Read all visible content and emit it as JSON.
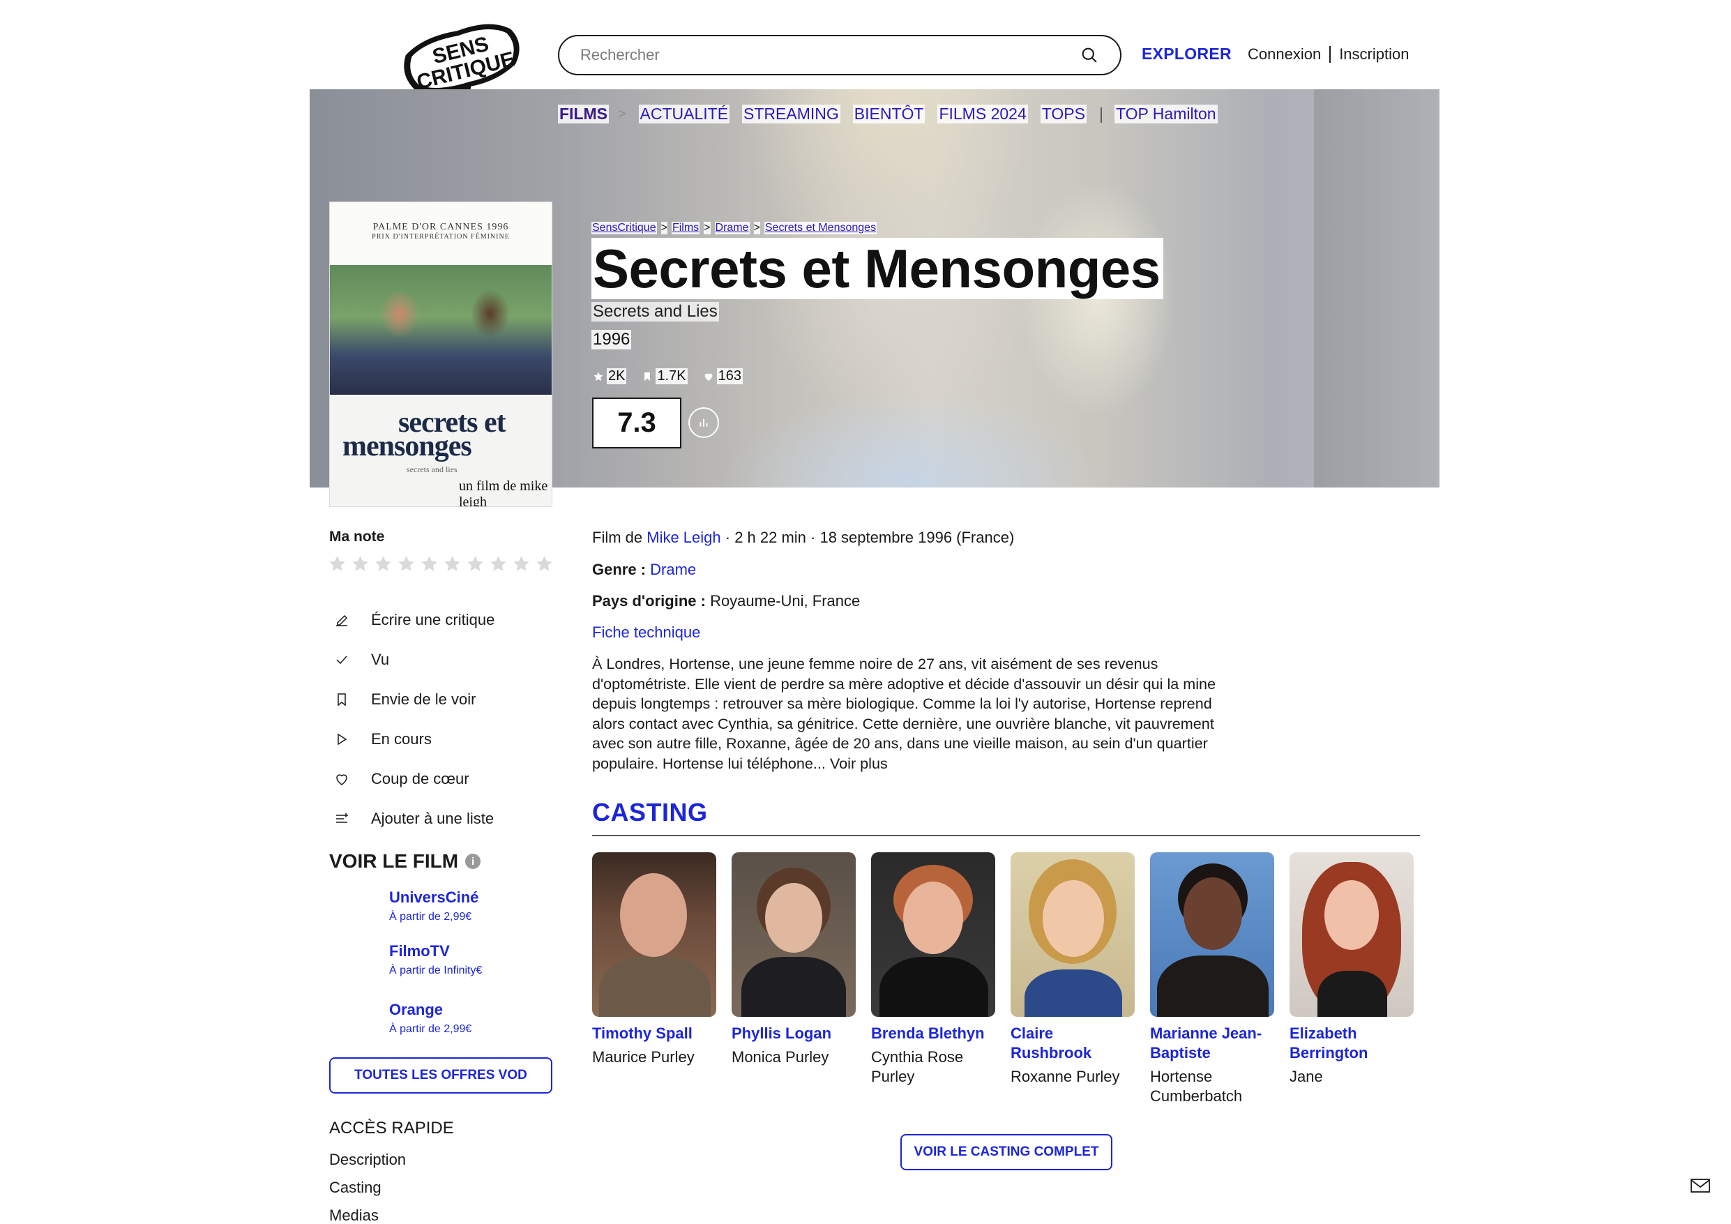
{
  "header": {
    "logo_text_1": "SENS",
    "logo_text_2": "CRITIQUE",
    "search_placeholder": "Rechercher",
    "explorer": "EXPLORER",
    "connexion": "Connexion",
    "inscription": "Inscription"
  },
  "subnav": {
    "films": "FILMS",
    "chevron": ">",
    "actualite": "ACTUALITÉ",
    "streaming": "STREAMING",
    "bientot": "BIENTÔT",
    "films2024": "FILMS 2024",
    "tops": "TOPS",
    "separator": "|",
    "top_hamilton": "TOP Hamilton"
  },
  "poster": {
    "award_1": "PALME D'OR CANNES 1996",
    "award_2": "PRIX D'INTERPRÉTATION FÉMININE",
    "title_1": "secrets et",
    "title_2": "mensonges",
    "subtitle": "secrets and lies",
    "director": "un film de mike leigh"
  },
  "breadcrumb": [
    "SensCritique",
    "Films",
    "Drame",
    "Secrets et Mensonges"
  ],
  "film": {
    "title": "Secrets et Mensonges",
    "original_title": "Secrets and Lies",
    "year": "1996",
    "ratings_count": "2K",
    "wishlist_count": "1.7K",
    "favorites_count": "163",
    "rating": "7.3",
    "meta_prefix": "Film de ",
    "director": "Mike Leigh",
    "meta_suffix": " · 2 h 22 min · 18 septembre 1996 (France)",
    "genre_label": "Genre : ",
    "genre": "Drame",
    "pays_label": "Pays d'origine : ",
    "pays": "Royaume-Uni, France",
    "fiche": "Fiche technique",
    "synopsis": "À Londres, Hortense, une jeune femme noire de 27 ans, vit aisément de ses revenus d'optométriste. Elle vient de perdre sa mère adoptive et décide d'assouvir un désir qui la mine depuis longtemps : retrouver sa mère biologique. Comme la loi l'y autorise, Hortense reprend alors contact avec Cynthia, sa génitrice. Cette dernière, une ouvrière blanche, vit pauvrement avec son autre fille, Roxanne, âgée de 20 ans, dans une vieille maison, au sein d'un quartier populaire. Hortense lui téléphone...",
    "voir_plus": "Voir plus"
  },
  "sidebar": {
    "ma_note": "Ma note",
    "stars_count": 10,
    "actions": [
      {
        "label": "Écrire une critique",
        "icon": "pencil-icon"
      },
      {
        "label": "Vu",
        "icon": "check-icon"
      },
      {
        "label": "Envie de le voir",
        "icon": "bookmark-icon"
      },
      {
        "label": "En cours",
        "icon": "play-icon"
      },
      {
        "label": "Coup de cœur",
        "icon": "heart-icon"
      },
      {
        "label": "Ajouter à une liste",
        "icon": "list-add-icon"
      }
    ],
    "voir_le_film": "VOIR LE FILM",
    "info": "i",
    "vod": [
      {
        "name": "UniversCiné",
        "price": "À partir de 2,99€"
      },
      {
        "name": "FilmoTV",
        "price": "À partir de Infinity€"
      },
      {
        "name": "Orange",
        "price": "À partir de 2,99€"
      }
    ],
    "all_vod": "TOUTES LES OFFRES VOD",
    "acces_rapide": "ACCÈS RAPIDE",
    "quick_links": [
      "Description",
      "Casting",
      "Medias"
    ]
  },
  "casting": {
    "title": "CASTING",
    "members": [
      {
        "actor": "Timothy Spall",
        "role": "Maurice Purley"
      },
      {
        "actor": "Phyllis Logan",
        "role": "Monica Purley"
      },
      {
        "actor": "Brenda Blethyn",
        "role": "Cynthia Rose Purley"
      },
      {
        "actor": "Claire Rushbrook",
        "role": "Roxanne Purley"
      },
      {
        "actor": "Marianne Jean-Baptiste",
        "role": "Hortense Cumberbatch"
      },
      {
        "actor": "Elizabeth Berrington",
        "role": "Jane"
      }
    ],
    "button": "VOIR LE CASTING COMPLET"
  },
  "colors": {
    "accent": "#1c26d8",
    "text": "#1a1a1a"
  }
}
